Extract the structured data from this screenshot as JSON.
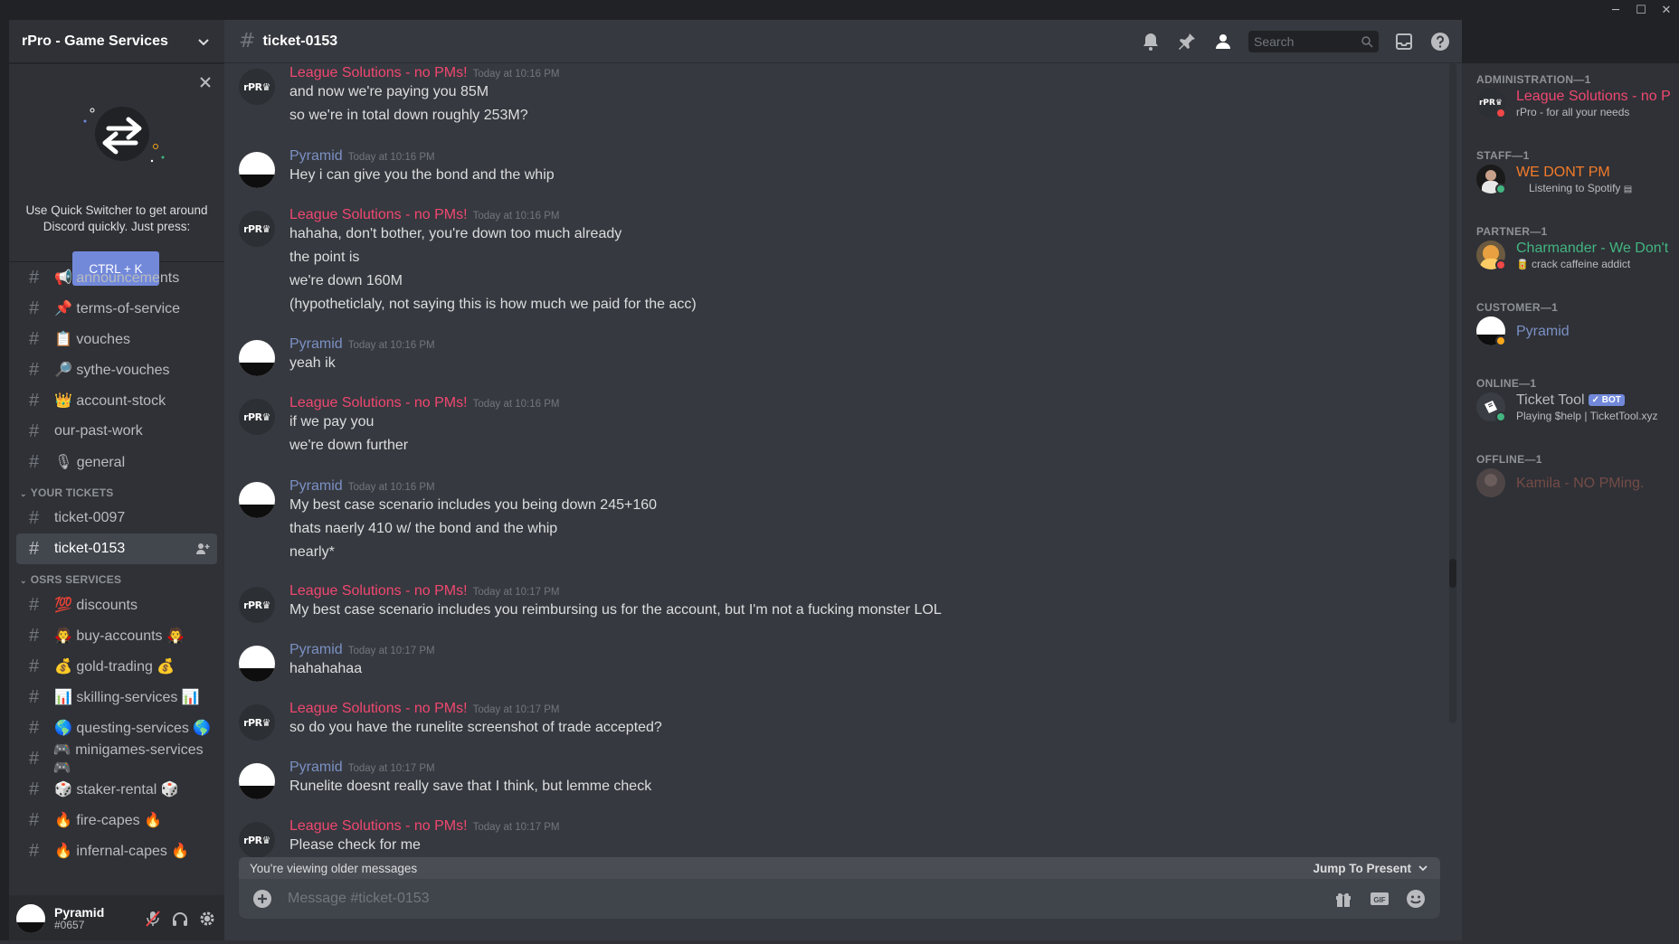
{
  "window": {
    "controls": [
      "─",
      "☐",
      "✕"
    ]
  },
  "guild": {
    "name": "rPro - Game Services"
  },
  "quick_switcher": {
    "text": "Use Quick Switcher to get around Discord quickly. Just press:",
    "shortcut": "CTRL + K"
  },
  "channels_top": [
    {
      "label": "📢 announcements"
    },
    {
      "label": "📌 terms-of-service"
    },
    {
      "label": "📋 vouches"
    },
    {
      "label": "🔎 sythe-vouches"
    },
    {
      "label": "👑 account-stock"
    },
    {
      "label": "our-past-work"
    },
    {
      "label": "🎙 general"
    }
  ],
  "categories": {
    "your_tickets": "YOUR TICKETS",
    "osrs_services": "OSRS SERVICES"
  },
  "tickets": [
    {
      "label": "ticket-0097"
    },
    {
      "label": "ticket-0153"
    }
  ],
  "osrs_channels": [
    {
      "label": "💯 discounts"
    },
    {
      "label": "🧛 buy-accounts 🧛"
    },
    {
      "label": "💰 gold-trading 💰"
    },
    {
      "label": "📊 skilling-services 📊"
    },
    {
      "label": "🌎 questing-services 🌎"
    },
    {
      "label": "🎮 minigames-services 🎮"
    },
    {
      "label": "🎲 staker-rental 🎲"
    },
    {
      "label": "🔥 fire-capes 🔥"
    },
    {
      "label": "🔥 infernal-capes 🔥"
    }
  ],
  "user": {
    "name": "Pyramid",
    "tag": "#0657"
  },
  "chat": {
    "channel": "ticket-0153",
    "search_placeholder": "Search",
    "composer_placeholder": "Message #ticket-0153",
    "older_label": "You're viewing older messages",
    "jump_label": "Jump To Present"
  },
  "messages": [
    {
      "author": "League Solutions - no PMs!",
      "time": "Today at 10:16 PM",
      "lines": [
        "and now we're paying you 85M",
        "so we're in total down roughly 253M?"
      ]
    },
    {
      "author": "Pyramid",
      "time": "Today at 10:16 PM",
      "lines": [
        "Hey i can give you the bond and the whip"
      ]
    },
    {
      "author": "League Solutions - no PMs!",
      "time": "Today at 10:16 PM",
      "lines": [
        "hahaha, don't bother, you're down too much already",
        "the point is",
        "we're down 160M",
        "(hypotheticlaly, not saying this is how much we paid for the acc)"
      ]
    },
    {
      "author": "Pyramid",
      "time": "Today at 10:16 PM",
      "lines": [
        "yeah ik"
      ]
    },
    {
      "author": "League Solutions - no PMs!",
      "time": "Today at 10:16 PM",
      "lines": [
        "if we pay you",
        "we're down further"
      ]
    },
    {
      "author": "Pyramid",
      "time": "Today at 10:16 PM",
      "lines": [
        "My best case scenario includes you being down 245+160",
        "thats naerly 410 w/ the bond and the whip",
        "nearly*"
      ]
    },
    {
      "author": "League Solutions - no PMs!",
      "time": "Today at 10:17 PM",
      "lines": [
        "My best case scenario includes you reimbursing us for the account, but I'm not a fucking monster LOL"
      ]
    },
    {
      "author": "Pyramid",
      "time": "Today at 10:17 PM",
      "lines": [
        "hahahahaa"
      ]
    },
    {
      "author": "League Solutions - no PMs!",
      "time": "Today at 10:17 PM",
      "lines": [
        "so do you have the runelite screenshot of trade accepted?"
      ]
    },
    {
      "author": "Pyramid",
      "time": "Today at 10:17 PM",
      "lines": [
        "Runelite doesnt really save that I think, but lemme check"
      ]
    },
    {
      "author": "League Solutions - no PMs!",
      "time": "Today at 10:17 PM",
      "lines": [
        "Please check for me"
      ]
    }
  ],
  "avatar_text": {
    "league": "rPR♛"
  },
  "members": {
    "groups": [
      "ADMINISTRATION—1",
      "STAFF—1",
      "PARTNER—1",
      "CUSTOMER—1",
      "ONLINE—1",
      "OFFLINE—1"
    ],
    "list": [
      {
        "name": "League Solutions - no PMs!",
        "sub": "rPro - for all your needs",
        "color": "#f04770"
      },
      {
        "name": "WE DONT PM",
        "sub": "Listening to Spotify",
        "color": "#f47b2a"
      },
      {
        "name": "Charmander - We Don't PM",
        "sub": "crack caffeine addict",
        "color": "#43b581"
      },
      {
        "name": "Pyramid",
        "sub": "",
        "color": "#7b90c4"
      },
      {
        "name": "Ticket Tool",
        "sub": "Playing $help | TicketTool.xyz",
        "color": "#b9bbbe",
        "badge": "✓ BOT"
      },
      {
        "name": "Kamila - NO PMing.",
        "sub": "",
        "color": "#6b4a44"
      }
    ]
  },
  "colors": {
    "accent": "#7289da",
    "league_red": "#f04770",
    "pyramid_blue": "#7b90c4"
  }
}
